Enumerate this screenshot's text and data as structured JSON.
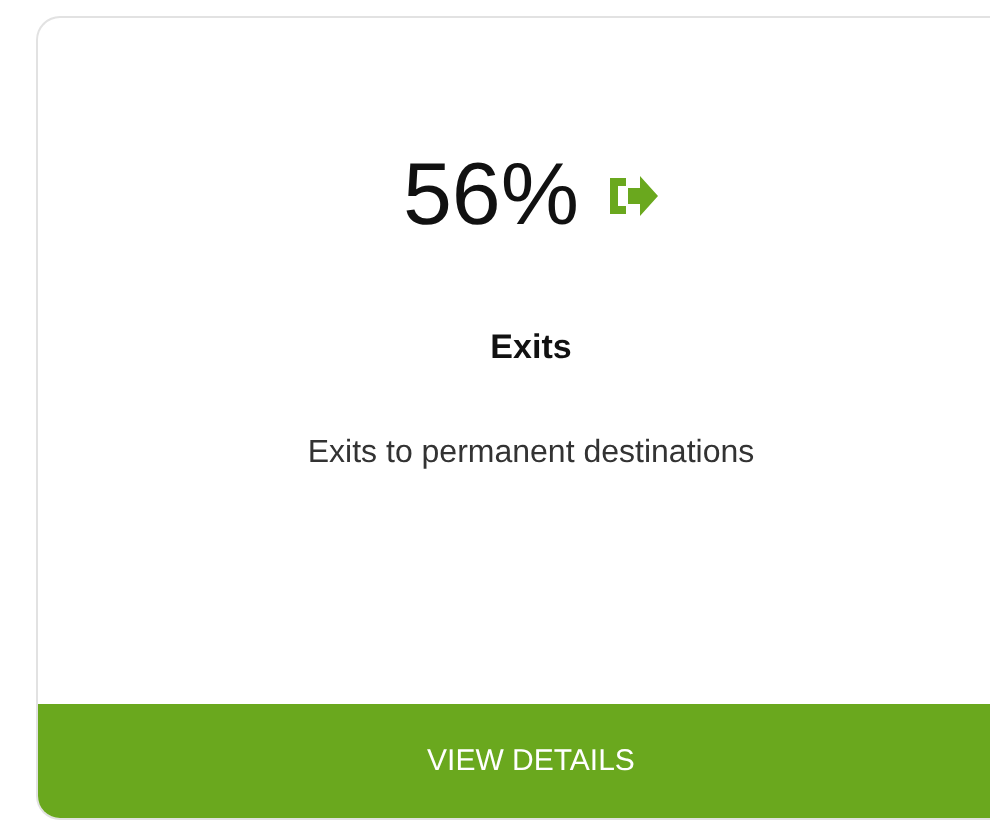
{
  "card": {
    "value": "56%",
    "title": "Exits",
    "description": "Exits to permanent destinations",
    "button": "VIEW DETAILS"
  }
}
